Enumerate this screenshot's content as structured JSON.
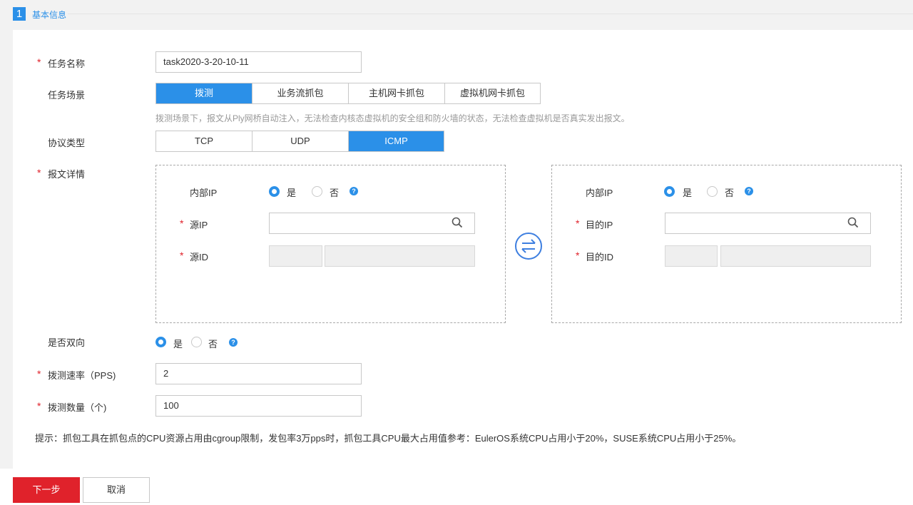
{
  "section": {
    "number": "1",
    "title": "基本信息"
  },
  "form": {
    "task_name": {
      "label": "任务名称",
      "value": "task2020-3-20-10-11"
    },
    "scenario": {
      "label": "任务场景",
      "options": [
        "拨测",
        "业务流抓包",
        "主机网卡抓包",
        "虚拟机网卡抓包"
      ],
      "selected": "拨测",
      "hint": "拨测场景下，报文从Ply网桥自动注入，无法检查内核态虚拟机的安全组和防火墙的状态，无法检查虚拟机是否真实发出报文。"
    },
    "protocol": {
      "label": "协议类型",
      "options": [
        "TCP",
        "UDP",
        "ICMP"
      ],
      "selected": "ICMP"
    },
    "packet_detail": {
      "label": "报文详情",
      "source": {
        "internal_ip_label": "内部IP",
        "yes": "是",
        "no": "否",
        "internal_ip_value": "是",
        "ip_label": "源IP",
        "ip_value": "",
        "id_label": "源ID"
      },
      "dest": {
        "internal_ip_label": "内部IP",
        "yes": "是",
        "no": "否",
        "internal_ip_value": "是",
        "ip_label": "目的IP",
        "ip_value": "",
        "id_label": "目的ID"
      }
    },
    "bidirectional": {
      "label": "是否双向",
      "yes": "是",
      "no": "否",
      "value": "是"
    },
    "rate": {
      "label": "拨测速率（PPS)",
      "value": "2"
    },
    "count": {
      "label": "拨测数量（个)",
      "value": "100"
    },
    "required_mark": "*",
    "help_glyph": "?"
  },
  "tip": "提示：抓包工具在抓包点的CPU资源占用由cgroup限制，发包率3万pps时，抓包工具CPU最大占用值参考：EulerOS系统CPU占用小于20%，SUSE系统CPU占用小于25%。",
  "footer": {
    "next": "下一步",
    "cancel": "取消"
  },
  "colors": {
    "accent": "#2b90e8",
    "required": "#e0222b",
    "primary_button": "#e0222b"
  },
  "icons": [
    "search-icon",
    "swap-icon",
    "help-icon"
  ]
}
